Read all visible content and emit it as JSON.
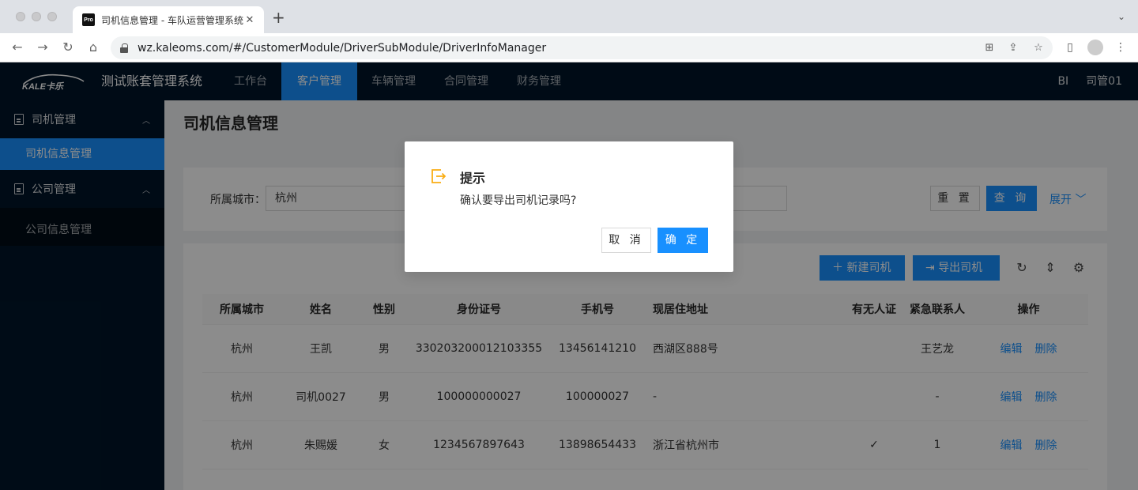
{
  "browser": {
    "tab_title": "司机信息管理 - 车队运营管理系统",
    "favicon_text": "Pro",
    "url": "wz.kaleoms.com/#/CustomerModule/DriverSubModule/DriverInfoManager"
  },
  "header": {
    "logo_text": "KALE卡乐",
    "system_name": "测试账套管理系统",
    "nav": [
      {
        "label": "工作台"
      },
      {
        "label": "客户管理"
      },
      {
        "label": "车辆管理"
      },
      {
        "label": "合同管理"
      },
      {
        "label": "财务管理"
      }
    ],
    "active_nav": "客户管理",
    "bi_label": "BI",
    "user_name": "司管01"
  },
  "sidebar": {
    "groups": [
      {
        "title": "司机管理",
        "items": [
          "司机信息管理"
        ]
      },
      {
        "title": "公司管理",
        "items": [
          "公司信息管理"
        ]
      }
    ],
    "selected_item": "司机信息管理"
  },
  "page": {
    "title": "司机信息管理"
  },
  "search": {
    "city_label": "所属城市：",
    "city_value": "杭州",
    "reset_label": "重 置",
    "query_label": "查 询",
    "expand_label": "展开"
  },
  "toolbar": {
    "new_driver_label": "新建司机",
    "export_driver_label": "导出司机"
  },
  "table": {
    "columns": [
      "所属城市",
      "姓名",
      "性别",
      "身份证号",
      "手机号",
      "现居住地址",
      "有无人证",
      "紧急联系人",
      "操作"
    ],
    "rows": [
      {
        "city": "杭州",
        "name": "王凯",
        "gender": "男",
        "id_no": "330203200012103355",
        "phone": "13456141210",
        "address": "西湖区888号",
        "has_cert": "",
        "emergency": "王艺龙",
        "edit": "编辑",
        "delete": "删除"
      },
      {
        "city": "杭州",
        "name": "司机0027",
        "gender": "男",
        "id_no": "100000000027",
        "phone": "100000027",
        "address": "-",
        "has_cert": "",
        "emergency": "-",
        "edit": "编辑",
        "delete": "删除"
      },
      {
        "city": "杭州",
        "name": "朱赐媛",
        "gender": "女",
        "id_no": "1234567897643",
        "phone": "13898654433",
        "address": "浙江省杭州市",
        "has_cert": "✓",
        "emergency": "1",
        "edit": "编辑",
        "delete": "删除"
      }
    ]
  },
  "modal": {
    "title": "提示",
    "content": "确认要导出司机记录吗?",
    "cancel_label": "取 消",
    "ok_label": "确 定",
    "icon_color": "#faad14"
  },
  "colors": {
    "primary": "#1890ff",
    "header_bg": "#001529",
    "warning": "#faad14"
  }
}
